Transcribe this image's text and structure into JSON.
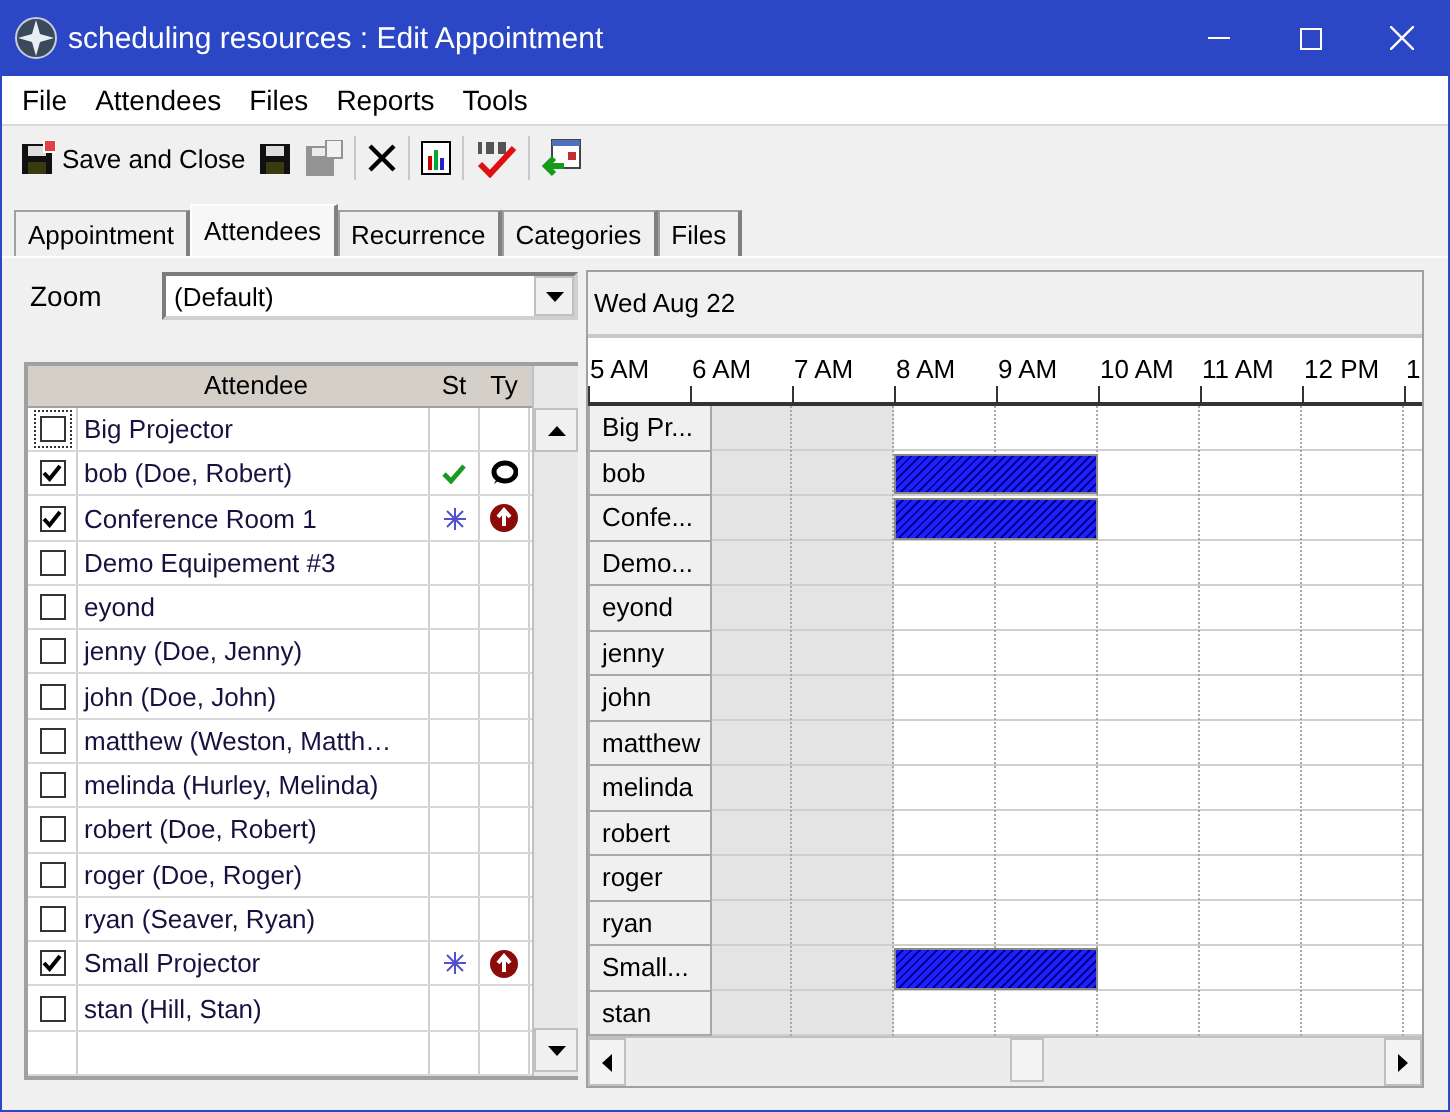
{
  "window": {
    "title": "scheduling resources : Edit Appointment"
  },
  "menu": [
    "File",
    "Attendees",
    "Files",
    "Reports",
    "Tools"
  ],
  "toolbar": [
    {
      "kind": "save-close",
      "label": "Save and Close",
      "disabled": false
    },
    {
      "kind": "save",
      "disabled": false
    },
    {
      "kind": "save-copy",
      "disabled": true
    },
    {
      "kind": "delete",
      "disabled": false
    },
    {
      "kind": "report",
      "disabled": false
    },
    {
      "kind": "spell",
      "disabled": false
    },
    {
      "kind": "import",
      "disabled": false
    }
  ],
  "tabs": [
    {
      "label": "Appointment",
      "selected": false
    },
    {
      "label": "Attendees",
      "selected": true
    },
    {
      "label": "Recurrence",
      "selected": false
    },
    {
      "label": "Categories",
      "selected": false
    },
    {
      "label": "Files",
      "selected": false
    }
  ],
  "zoom": {
    "label": "Zoom",
    "value": "(Default)"
  },
  "table": {
    "columns": [
      "Attendee",
      "St",
      "Ty"
    ]
  },
  "attendees": [
    {
      "name": "Big Projector",
      "short": "Big Pr...",
      "checked": false,
      "focused": true,
      "busy": false
    },
    {
      "name": "bob (Doe, Robert)",
      "short": "bob",
      "checked": true,
      "focused": false,
      "status": {
        "kind": "accepted"
      },
      "type": {
        "kind": "speech"
      },
      "busy": true
    },
    {
      "name": "Conference Room 1",
      "short": "Confe...",
      "checked": true,
      "focused": false,
      "status": {
        "kind": "pending"
      },
      "type": {
        "kind": "up-arrow"
      },
      "busy": true
    },
    {
      "name": "Demo Equipement #3",
      "short": "Demo...",
      "checked": false,
      "focused": false,
      "busy": false
    },
    {
      "name": "eyond",
      "short": "eyond",
      "checked": false,
      "focused": false,
      "busy": false
    },
    {
      "name": "jenny (Doe, Jenny)",
      "short": "jenny",
      "checked": false,
      "focused": false,
      "busy": false
    },
    {
      "name": "john (Doe, John)",
      "short": "john",
      "checked": false,
      "focused": false,
      "busy": false
    },
    {
      "name": "matthew (Weston, Matth…",
      "short": "matthew",
      "checked": false,
      "focused": false,
      "busy": false
    },
    {
      "name": "melinda (Hurley, Melinda)",
      "short": "melinda",
      "checked": false,
      "focused": false,
      "busy": false
    },
    {
      "name": "robert (Doe, Robert)",
      "short": "robert",
      "checked": false,
      "focused": false,
      "busy": false
    },
    {
      "name": "roger (Doe, Roger)",
      "short": "roger",
      "checked": false,
      "focused": false,
      "busy": false
    },
    {
      "name": "ryan (Seaver, Ryan)",
      "short": "ryan",
      "checked": false,
      "focused": false,
      "busy": false
    },
    {
      "name": "Small Projector",
      "short": "Small...",
      "checked": true,
      "focused": false,
      "status": {
        "kind": "pending"
      },
      "type": {
        "kind": "up-arrow"
      },
      "busy": true
    },
    {
      "name": "stan (Hill, Stan)",
      "short": "stan",
      "checked": false,
      "focused": false,
      "busy": false
    }
  ],
  "schedule": {
    "date": "Wed Aug 22",
    "hours": [
      {
        "label": "5 AM"
      },
      {
        "label": "6 AM",
        "shaded": true,
        "selected": false
      },
      {
        "label": "7 AM",
        "shaded": true,
        "selected": false
      },
      {
        "label": "8 AM",
        "shaded": false,
        "selected": true
      },
      {
        "label": "9 AM",
        "shaded": false,
        "selected": true
      },
      {
        "label": "10 AM",
        "shaded": false,
        "selected": false
      },
      {
        "label": "11 AM",
        "shaded": false,
        "selected": false
      },
      {
        "label": "12 PM",
        "shaded": false,
        "selected": false
      },
      {
        "label": "1",
        "shaded": false,
        "selected": false
      }
    ]
  }
}
